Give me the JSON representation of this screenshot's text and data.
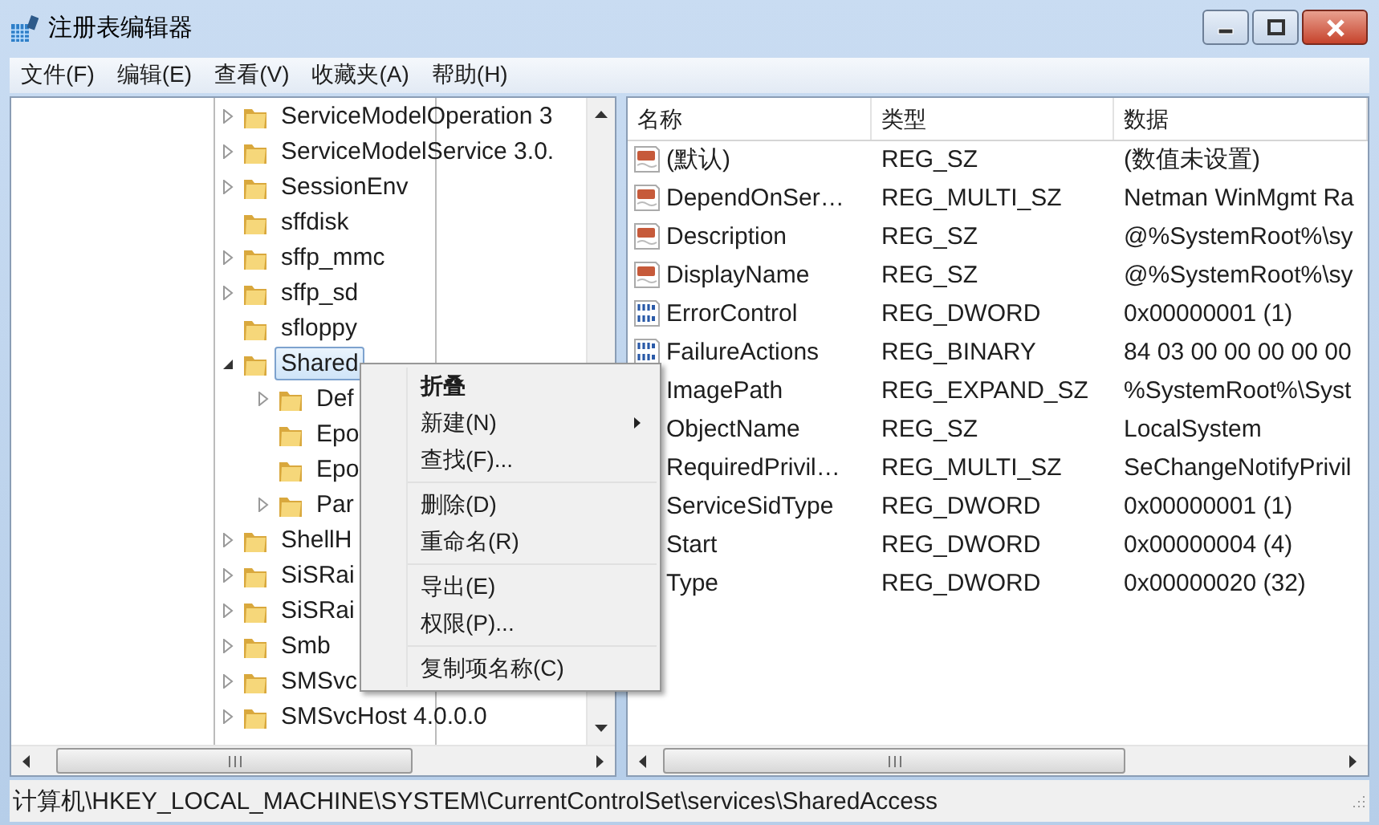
{
  "window": {
    "title": "注册表编辑器"
  },
  "menu_bar": [
    {
      "label": "文件(F)"
    },
    {
      "label": "编辑(E)"
    },
    {
      "label": "查看(V)"
    },
    {
      "label": "收藏夹(A)"
    },
    {
      "label": "帮助(H)"
    }
  ],
  "tree": {
    "items": [
      {
        "label": "ServiceModelOperation 3",
        "kind": "collapsed",
        "selected": false
      },
      {
        "label": "ServiceModelService 3.0.",
        "kind": "collapsed",
        "selected": false
      },
      {
        "label": "SessionEnv",
        "kind": "collapsed",
        "selected": false
      },
      {
        "label": "sffdisk",
        "kind": "leaf",
        "selected": false
      },
      {
        "label": "sffp_mmc",
        "kind": "collapsed",
        "selected": false
      },
      {
        "label": "sffp_sd",
        "kind": "collapsed",
        "selected": false
      },
      {
        "label": "sfloppy",
        "kind": "leaf",
        "selected": false
      },
      {
        "label": "Shared",
        "kind": "expanded",
        "selected": true,
        "children": [
          {
            "label": "Def",
            "kind": "collapsed",
            "selected": false
          },
          {
            "label": "Epo",
            "kind": "leaf",
            "selected": false
          },
          {
            "label": "Epo",
            "kind": "leaf",
            "selected": false
          },
          {
            "label": "Par",
            "kind": "collapsed",
            "selected": false
          }
        ]
      },
      {
        "label": "ShellH",
        "kind": "collapsed",
        "selected": false
      },
      {
        "label": "SiSRai",
        "kind": "collapsed",
        "selected": false
      },
      {
        "label": "SiSRai",
        "kind": "collapsed",
        "selected": false
      },
      {
        "label": "Smb",
        "kind": "collapsed",
        "selected": false
      },
      {
        "label": "SMSvc",
        "kind": "collapsed",
        "selected": false
      },
      {
        "label": "SMSvcHost 4.0.0.0",
        "kind": "collapsed",
        "selected": false
      }
    ]
  },
  "values_table": {
    "columns": [
      "名称",
      "类型",
      "数据"
    ],
    "rows": [
      {
        "kind": "string",
        "name": "(默认)",
        "type": "REG_SZ",
        "data": "(数值未设置)"
      },
      {
        "kind": "string",
        "name": "DependOnSer…",
        "type": "REG_MULTI_SZ",
        "data": "Netman WinMgmt Ra"
      },
      {
        "kind": "string",
        "name": "Description",
        "type": "REG_SZ",
        "data": "@%SystemRoot%\\sy"
      },
      {
        "kind": "string",
        "name": "DisplayName",
        "type": "REG_SZ",
        "data": "@%SystemRoot%\\sy"
      },
      {
        "kind": "binary",
        "name": "ErrorControl",
        "type": "REG_DWORD",
        "data": "0x00000001 (1)"
      },
      {
        "kind": "binary",
        "name": "FailureActions",
        "type": "REG_BINARY",
        "data": "84 03 00 00 00 00 00"
      },
      {
        "kind": "covered",
        "name": "ImagePath",
        "type": "REG_EXPAND_SZ",
        "data": "%SystemRoot%\\Syst"
      },
      {
        "kind": "covered",
        "name": "ObjectName",
        "type": "REG_SZ",
        "data": "LocalSystem"
      },
      {
        "kind": "covered",
        "name": "RequiredPrivil…",
        "type": "REG_MULTI_SZ",
        "data": "SeChangeNotifyPrivil"
      },
      {
        "kind": "covered",
        "name": "ServiceSidType",
        "type": "REG_DWORD",
        "data": "0x00000001 (1)"
      },
      {
        "kind": "covered",
        "name": "Start",
        "type": "REG_DWORD",
        "data": "0x00000004 (4)"
      },
      {
        "kind": "covered",
        "name": "Type",
        "type": "REG_DWORD",
        "data": "0x00000020 (32)"
      }
    ]
  },
  "context_menu": {
    "items": [
      {
        "kind": "item",
        "label": "折叠",
        "default": true,
        "submenu": false
      },
      {
        "kind": "item",
        "label": "新建(N)",
        "default": false,
        "submenu": true
      },
      {
        "kind": "item",
        "label": "查找(F)...",
        "default": false,
        "submenu": false
      },
      {
        "kind": "separator"
      },
      {
        "kind": "item",
        "label": "删除(D)",
        "default": false,
        "submenu": false
      },
      {
        "kind": "item",
        "label": "重命名(R)",
        "default": false,
        "submenu": false
      },
      {
        "kind": "separator"
      },
      {
        "kind": "item",
        "label": "导出(E)",
        "default": false,
        "submenu": false
      },
      {
        "kind": "item",
        "label": "权限(P)...",
        "default": false,
        "submenu": false
      },
      {
        "kind": "separator"
      },
      {
        "kind": "item",
        "label": "复制项名称(C)",
        "default": false,
        "submenu": false
      }
    ]
  },
  "status_bar": {
    "path": "计算机\\HKEY_LOCAL_MACHINE\\SYSTEM\\CurrentControlSet\\services\\SharedAccess"
  }
}
